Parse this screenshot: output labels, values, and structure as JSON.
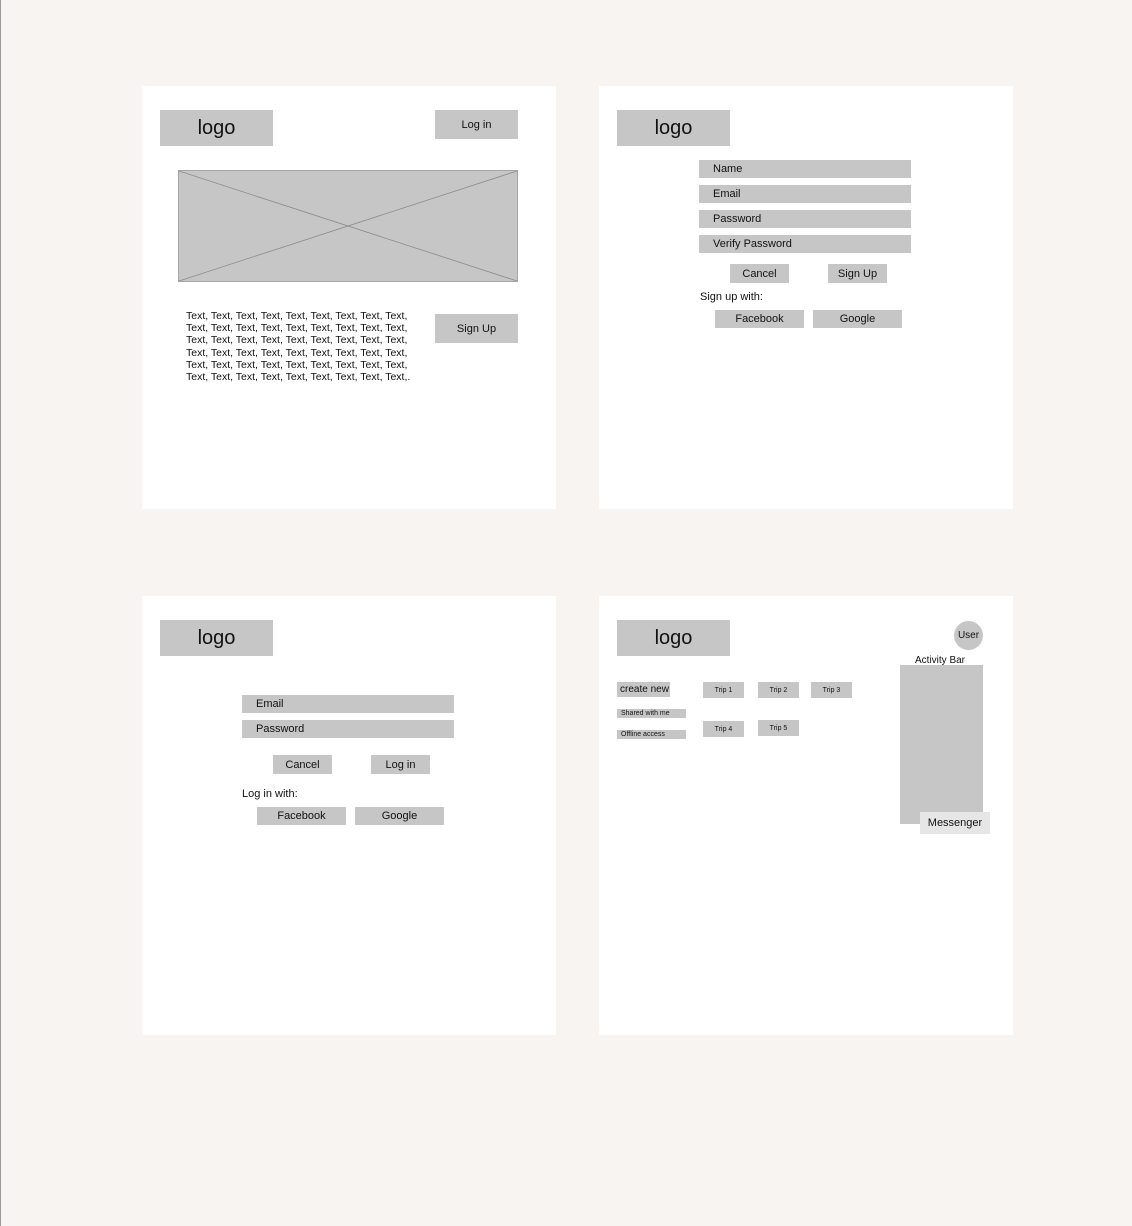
{
  "colors": {
    "background": "#f7f4f2",
    "frame": "#ffffff",
    "placeholder": "#c6c6c6",
    "messenger": "#e6e6e6"
  },
  "landing": {
    "logo": "logo",
    "login_button": "Log in",
    "hero_image": "image-placeholder-icon",
    "body_text": "Text, Text, Text, Text, Text, Text, Text, Text, Text, Text, Text, Text, Text, Text, Text, Text, Text, Text, Text, Text, Text, Text, Text, Text, Text, Text, Text, Text, Text, Text, Text, Text, Text, Text, Text, Text, Text, Text, Text, Text, Text, Text, Text, Text, Text, Text, Text, Text, Text, Text, Text, Text, Text, Text,.",
    "signup_button": "Sign Up"
  },
  "signup": {
    "logo": "logo",
    "name_field": "Name",
    "email_field": "Email",
    "password_field": "Password",
    "verify_password_field": "Verify Password",
    "cancel_button": "Cancel",
    "signup_button": "Sign Up",
    "signup_with_label": "Sign up with:",
    "facebook_button": "Facebook",
    "google_button": "Google"
  },
  "login": {
    "logo": "logo",
    "email_field": "Email",
    "password_field": "Password",
    "cancel_button": "Cancel",
    "login_button": "Log in",
    "login_with_label": "Log in with:",
    "facebook_button": "Facebook",
    "google_button": "Google"
  },
  "dashboard": {
    "logo": "logo",
    "user_avatar": "User",
    "activity_bar_label": "Activity Bar",
    "create_new": "create new",
    "shared_with_me": "Shared with me",
    "offline_access": "Offline access",
    "trips": [
      "Trip 1",
      "Trip 2",
      "Trip 3",
      "Trip 4",
      "Trip 5"
    ],
    "messenger_button": "Messenger"
  }
}
